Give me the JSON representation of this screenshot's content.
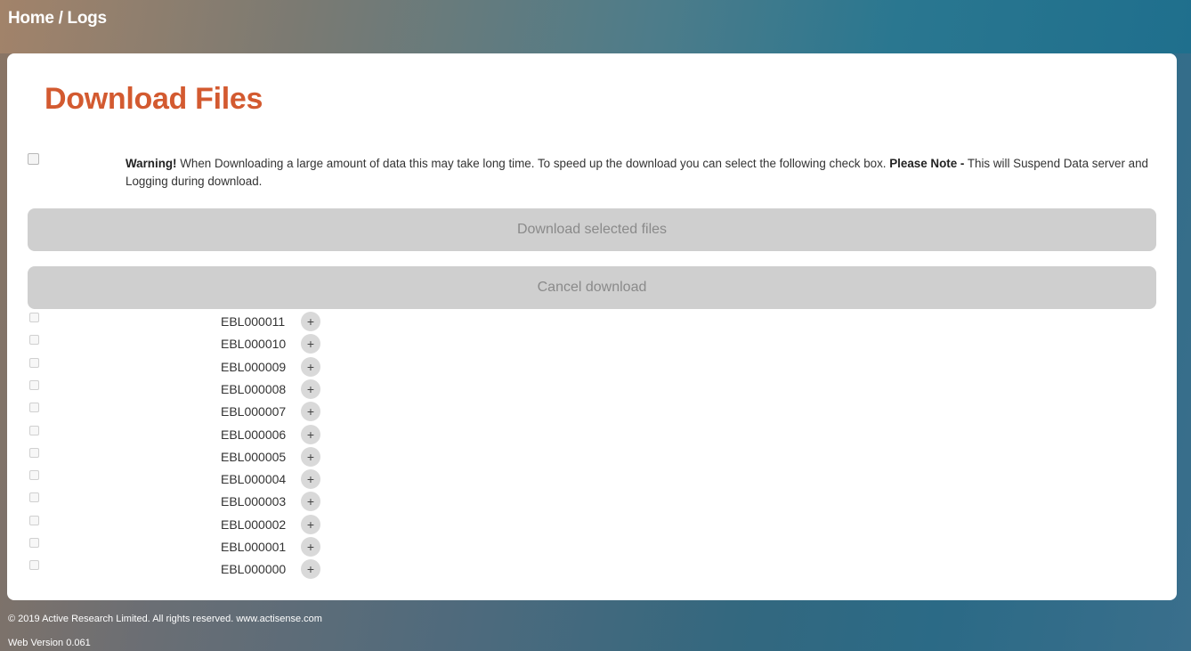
{
  "breadcrumb": {
    "home": "Home",
    "separator": " / ",
    "current": "Logs"
  },
  "page": {
    "title": "Download Files"
  },
  "warning": {
    "label": "Warning!",
    "text": " When Downloading a large amount of data this may take long time. To speed up the download you can select the following check box. ",
    "note_label": "Please Note -",
    "note_text": " This will Suspend Data server and Logging during download.",
    "suspend_checked": false
  },
  "buttons": {
    "download_selected": "Download selected files",
    "cancel_download": "Cancel download"
  },
  "files": [
    {
      "name": "EBL000011",
      "expand": "+",
      "checked": false
    },
    {
      "name": "EBL000010",
      "expand": "+",
      "checked": false
    },
    {
      "name": "EBL000009",
      "expand": "+",
      "checked": false
    },
    {
      "name": "EBL000008",
      "expand": "+",
      "checked": false
    },
    {
      "name": "EBL000007",
      "expand": "+",
      "checked": false
    },
    {
      "name": "EBL000006",
      "expand": "+",
      "checked": false
    },
    {
      "name": "EBL000005",
      "expand": "+",
      "checked": false
    },
    {
      "name": "EBL000004",
      "expand": "+",
      "checked": false
    },
    {
      "name": "EBL000003",
      "expand": "+",
      "checked": false
    },
    {
      "name": "EBL000002",
      "expand": "+",
      "checked": false
    },
    {
      "name": "EBL000001",
      "expand": "+",
      "checked": false
    },
    {
      "name": "EBL000000",
      "expand": "+",
      "checked": false
    }
  ],
  "footer": {
    "copyright": "© 2019 Active Research Limited. All rights reserved.  www.actisense.com",
    "version": "Web Version 0.061"
  },
  "colors": {
    "title": "#d35a30",
    "button_bg": "#cfcfcf",
    "button_text": "#8a8a8a"
  }
}
